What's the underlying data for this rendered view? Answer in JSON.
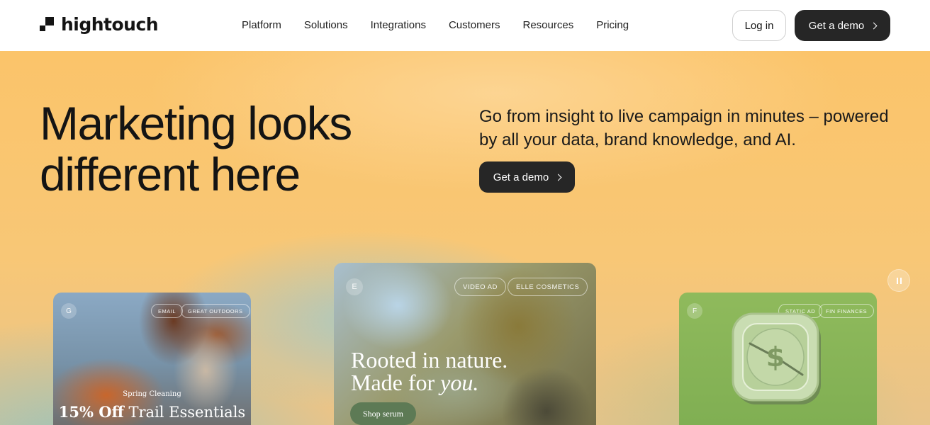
{
  "header": {
    "logo_text": "hightouch",
    "nav": [
      "Platform",
      "Solutions",
      "Integrations",
      "Customers",
      "Resources",
      "Pricing"
    ],
    "login_label": "Log in",
    "demo_label": "Get a demo"
  },
  "hero": {
    "headline_line1": "Marketing looks",
    "headline_line2": "different here",
    "subcopy": "Go from insight to live campaign in minutes – powered by all your data, brand knowledge, and AI.",
    "demo_label": "Get a demo"
  },
  "cards": {
    "left": {
      "letter": "G",
      "tags": [
        "EMAIL",
        "GREAT OUTDOORS"
      ],
      "subtitle": "Spring Cleaning",
      "title_bold": "15% Off",
      "title_rest": " Trail Essentials"
    },
    "middle": {
      "letter": "E",
      "tags": [
        "VIDEO AD",
        "ELLE COSMETICS"
      ],
      "line1": "Rooted in nature.",
      "line2_prefix": "Made for ",
      "line2_italic": "you.",
      "button": "Shop serum"
    },
    "right": {
      "letter": "F",
      "tags": [
        "STATIC AD",
        "FIN FINANCES"
      ],
      "dial_symbol": "$"
    }
  },
  "icons": {
    "logo": "hightouch-logo-icon",
    "chevron": "chevron-right-icon",
    "pause": "pause-icon",
    "clock": "dollar-clock-icon"
  }
}
